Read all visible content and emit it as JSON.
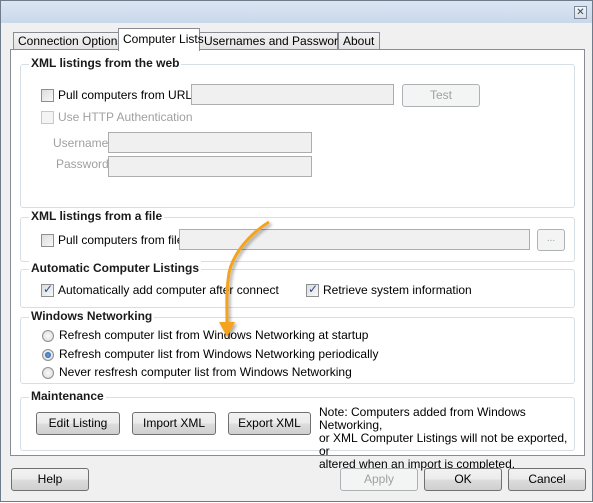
{
  "window": {
    "close_icon": "close-icon"
  },
  "tabs": [
    {
      "label": "Connection Options",
      "active": false
    },
    {
      "label": "Computer Lists",
      "active": true
    },
    {
      "label": "Usernames and Passwords",
      "active": false
    },
    {
      "label": "About",
      "active": false
    }
  ],
  "web_group": {
    "title": "XML listings from the web",
    "pull_url_label": "Pull computers from URL:",
    "pull_url_checked": false,
    "url_value": "",
    "test_button": "Test",
    "http_auth_label": "Use HTTP Authentication",
    "http_auth_checked": false,
    "username_label": "Username:",
    "username_value": "",
    "password_label": "Password:",
    "password_value": ""
  },
  "file_group": {
    "title": "XML listings from a file",
    "pull_file_label": "Pull computers from file:",
    "pull_file_checked": false,
    "file_value": "",
    "browse_button": "..."
  },
  "auto_group": {
    "title": "Automatic Computer Listings",
    "auto_add_label": "Automatically add computer after connect",
    "auto_add_checked": true,
    "retrieve_label": "Retrieve system information",
    "retrieve_checked": true
  },
  "network_group": {
    "title": "Windows Networking",
    "options": [
      {
        "label": "Refresh computer list from Windows Networking at startup",
        "selected": false
      },
      {
        "label": "Refresh computer list from Windows Networking periodically",
        "selected": true
      },
      {
        "label": "Never resfresh computer list from Windows Networking",
        "selected": false
      }
    ]
  },
  "maintenance_group": {
    "title": "Maintenance",
    "edit_button": "Edit Listing",
    "import_button": "Import XML",
    "export_button": "Export XML",
    "note_lines": [
      "Note: Computers added from Windows Networking,",
      "or XML Computer Listings will not be exported, or",
      "altered when an import is completed."
    ]
  },
  "footer": {
    "help_button": "Help",
    "apply_button": "Apply",
    "ok_button": "OK",
    "cancel_button": "Cancel"
  },
  "annotation": {
    "arrow_color": "#f5a21f"
  }
}
